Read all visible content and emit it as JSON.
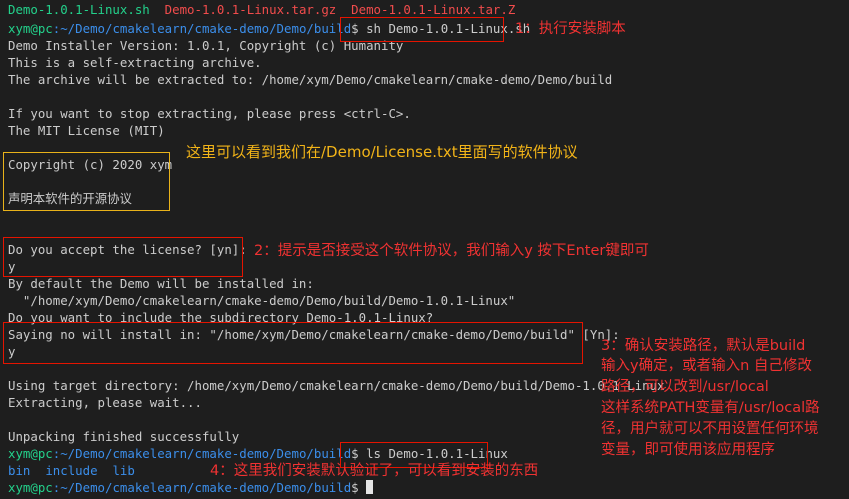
{
  "terminal": {
    "files_top": [
      "Demo-1.0.1-Linux.sh",
      "Demo-1.0.1-Linux.tar.gz",
      "Demo-1.0.1-Linux.tar.Z"
    ],
    "prompt_user": "xym@pc",
    "prompt_path": ":~/Demo/cmakelearn/cmake-demo/Demo/build",
    "prompt_symbol": "$ ",
    "cmd1": "sh Demo-1.0.1-Linux.sh",
    "out_installer_version": "Demo Installer Version: 1.0.1, Copyright (c) Humanity",
    "out_self_extracting": "This is a self-extracting archive.",
    "out_extract_to": "The archive will be extracted to: /home/xym/Demo/cmakelearn/cmake-demo/Demo/build",
    "out_stop": "If you want to stop extracting, please press <ctrl-C>.",
    "out_license_name": "The MIT License (MIT)",
    "out_copyright": "Copyright (c) 2020 xym",
    "out_license_cn": "声明本软件的开源协议",
    "out_accept": "Do you accept the license? [yn]:",
    "input_y1": "y",
    "out_default_install": "By default the Demo will be installed in:",
    "out_default_path": "  \"/home/xym/Demo/cmakelearn/cmake-demo/Demo/build/Demo-1.0.1-Linux\"",
    "out_subdir": "Do you want to include the subdirectory Demo-1.0.1-Linux?",
    "out_saying_no": "Saying no will install in: \"/home/xym/Demo/cmakelearn/cmake-demo/Demo/build\" [Yn]:",
    "input_y2": "y",
    "out_using_target": "Using target directory: /home/xym/Demo/cmakelearn/cmake-demo/Demo/build/Demo-1.0.1-Linux",
    "out_extracting": "Extracting, please wait...",
    "out_unpacking": "Unpacking finished successfully",
    "cmd2": "ls Demo-1.0.1-Linux",
    "ls_items": [
      "bin",
      "include",
      "lib"
    ]
  },
  "annotations": {
    "note1": "1：执行安装脚本",
    "note_license": "这里可以看到我们在/Demo/License.txt里面写的软件协议",
    "note2": "2：提示是否接受这个软件协议，我们输入y 按下Enter键即可",
    "note3_lines": [
      "3：确认安装路径，默认是build",
      "输入y确定，或者输入n 自己修改",
      "路径，可以改到/usr/local",
      "这样系统PATH变量有/usr/local路",
      "径，用户就可以不用设置任何环境",
      "变量，即可使用该应用程序"
    ],
    "note4": "4：这里我们安装默认验证了，可以看到安装的东西"
  }
}
